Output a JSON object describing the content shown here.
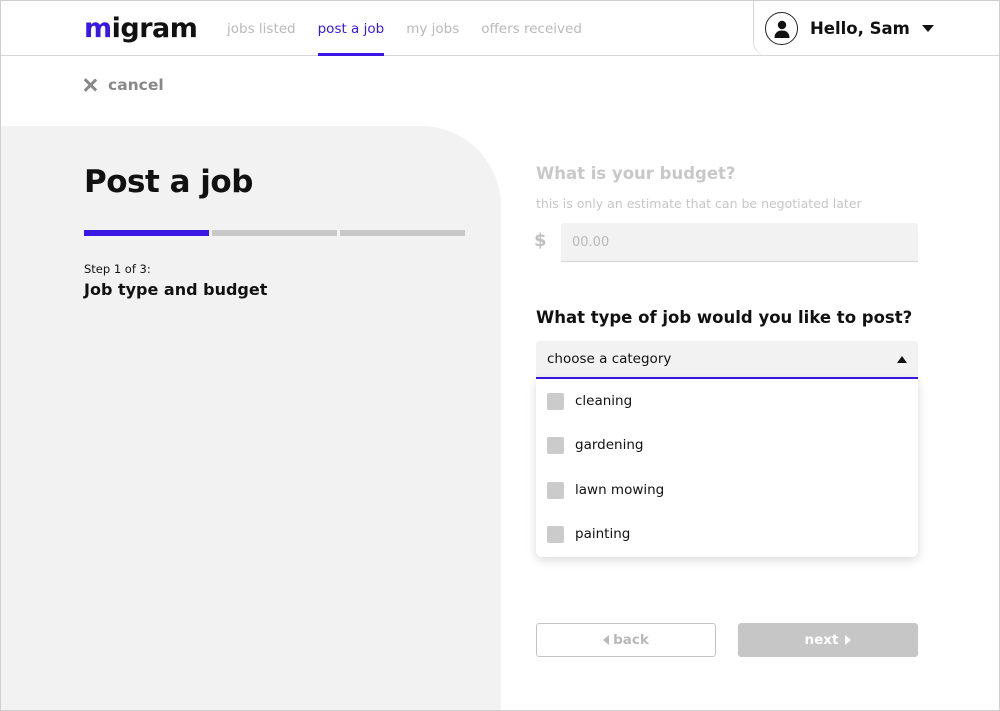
{
  "header": {
    "logo_text": "migram",
    "nav": [
      {
        "label": "jobs listed",
        "active": false
      },
      {
        "label": "post a job",
        "active": true
      },
      {
        "label": "my jobs",
        "active": false
      },
      {
        "label": "offers received",
        "active": false
      }
    ],
    "user_greeting": "Hello, Sam",
    "avatar_icon": "user-icon",
    "dropdown_icon": "caret-down-icon"
  },
  "cancel": {
    "label": "cancel",
    "icon": "close-icon"
  },
  "left": {
    "title": "Post a job",
    "progress": {
      "total_steps": 3,
      "current_step": 1
    },
    "step_number": "Step 1 of 3:",
    "step_title": "Job type and budget"
  },
  "budget": {
    "question": "What is your budget?",
    "hint": "this is only an estimate that can be negotiated later",
    "currency_symbol": "$",
    "placeholder": "00.00"
  },
  "job_type": {
    "question": "What type of job would you like to post?",
    "selected_label": "choose a category",
    "options": [
      "cleaning",
      "gardening",
      "lawn mowing",
      "painting"
    ]
  },
  "buttons": {
    "back": "back",
    "next": "next"
  },
  "colors": {
    "accent": "#3b17e6",
    "panel": "#f2f2f2",
    "muted": "#b9b9b9",
    "disabled": "#c6c6c6"
  }
}
